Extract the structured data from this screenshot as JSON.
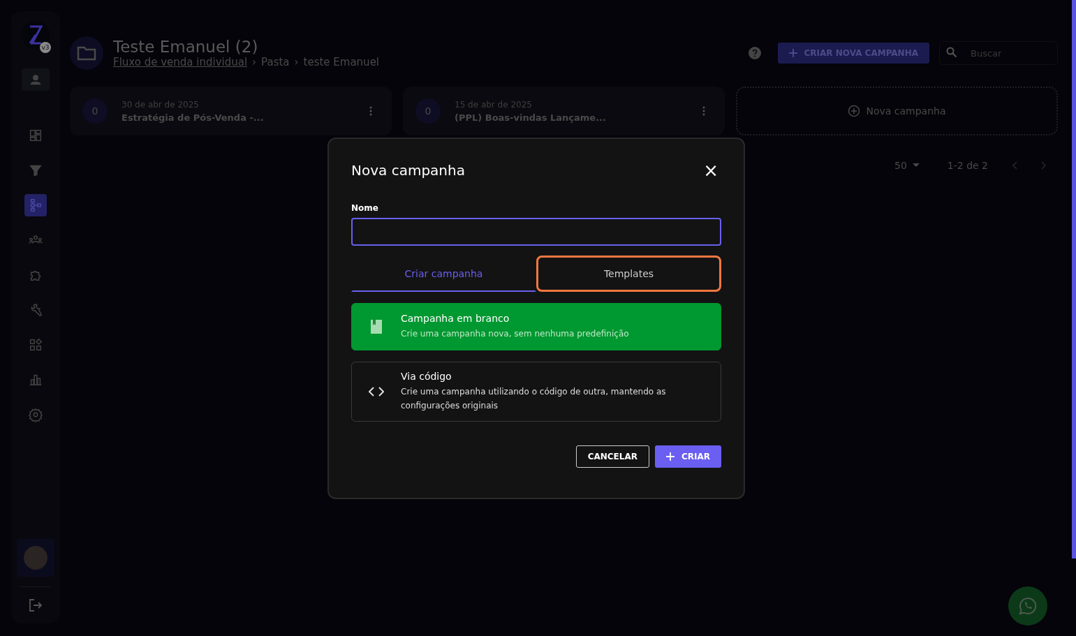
{
  "sidebar": {
    "logo_badge": "v3",
    "items": [
      {
        "selected": false
      },
      {
        "selected": false
      },
      {
        "selected": false
      },
      {
        "selected": true
      },
      {
        "selected": false
      },
      {
        "selected": false
      },
      {
        "selected": false
      },
      {
        "selected": false
      },
      {
        "selected": false
      },
      {
        "selected": false
      }
    ]
  },
  "header": {
    "title": "Teste Emanuel (2)",
    "breadcrumb": [
      {
        "label": "Fluxo de venda individual",
        "link": true
      },
      {
        "label": "Pasta",
        "link": false
      },
      {
        "label": "teste Emanuel",
        "link": false
      }
    ],
    "separator": "›",
    "create_button": "CRIAR NOVA CAMPANHA",
    "search": {
      "placeholder": "Buscar"
    }
  },
  "cards": [
    {
      "count": "0",
      "date": "30 de abr de 2025",
      "name": "Estratégia de Pós-Venda -..."
    },
    {
      "count": "0",
      "date": "15 de abr de 2025",
      "name": "(PPL) Boas-vindas Lançame..."
    }
  ],
  "new_card": "Nova campanha",
  "pagination": {
    "per_page": "50",
    "range": "1-2 de 2"
  },
  "dialog": {
    "title": "Nova campanha",
    "close": "×",
    "name_label": "Nome",
    "tabs": [
      {
        "label": "Criar campanha",
        "selected": true,
        "focused": false
      },
      {
        "label": "Templates",
        "selected": false,
        "focused": true
      }
    ],
    "options": [
      {
        "title": "Campanha em branco",
        "description": "Crie uma campanha nova, sem nenhuma predefinição",
        "selected": true
      },
      {
        "title": "Via código",
        "description": "Crie uma campanha utilizando o código de outra, mantendo as configurações originais",
        "selected": false
      }
    ],
    "cancel": "CANCELAR",
    "create": "CRIAR"
  }
}
